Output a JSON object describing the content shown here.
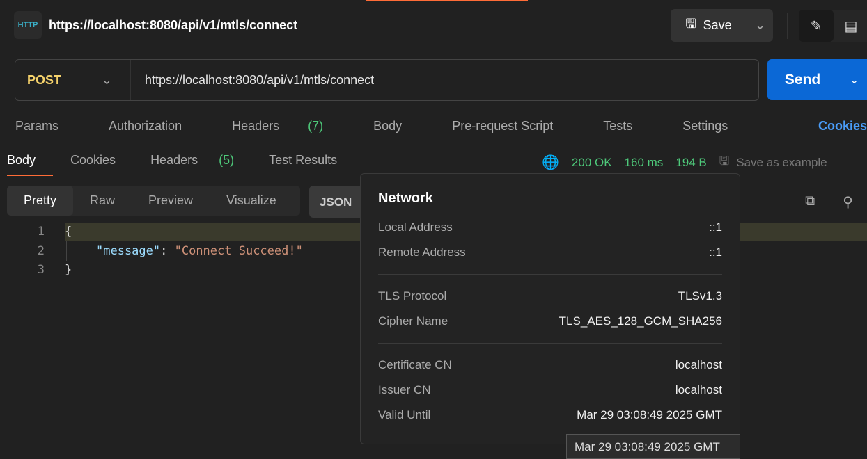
{
  "header": {
    "icon_text": "HTTP",
    "title": "https://localhost:8080/api/v1/mtls/connect",
    "save_label": "Save"
  },
  "request": {
    "method": "POST",
    "url": "https://localhost:8080/api/v1/mtls/connect",
    "send_label": "Send"
  },
  "request_tabs": [
    {
      "label": "Params"
    },
    {
      "label": "Authorization"
    },
    {
      "label": "Headers",
      "count": "(7)"
    },
    {
      "label": "Body"
    },
    {
      "label": "Pre-request Script"
    },
    {
      "label": "Tests"
    },
    {
      "label": "Settings"
    }
  ],
  "cookies_link": "Cookies",
  "response_tabs": [
    {
      "label": "Body",
      "active": true
    },
    {
      "label": "Cookies"
    },
    {
      "label": "Headers",
      "count": "(5)"
    },
    {
      "label": "Test Results"
    }
  ],
  "status": {
    "code": "200 OK",
    "time": "160 ms",
    "size": "194 B",
    "save_example": "Save as example",
    "color": "#4ec97a"
  },
  "format_tabs": [
    "Pretty",
    "Raw",
    "Preview",
    "Visualize"
  ],
  "format_type": "JSON",
  "code": {
    "lines": [
      "1",
      "2",
      "3"
    ],
    "open": "{",
    "key": "\"message\"",
    "colon": ": ",
    "value": "\"Connect Succeed!\"",
    "close": "}"
  },
  "network": {
    "title": "Network",
    "groups": [
      [
        {
          "label": "Local Address",
          "value": "::1"
        },
        {
          "label": "Remote Address",
          "value": "::1"
        }
      ],
      [
        {
          "label": "TLS Protocol",
          "value": "TLSv1.3"
        },
        {
          "label": "Cipher Name",
          "value": "TLS_AES_128_GCM_SHA256"
        }
      ],
      [
        {
          "label": "Certificate CN",
          "value": "localhost"
        },
        {
          "label": "Issuer CN",
          "value": "localhost"
        },
        {
          "label": "Valid Until",
          "value": "Mar 29 03:08:49 2025 GMT"
        }
      ]
    ]
  },
  "tooltip": "Mar 29 03:08:49 2025 GMT"
}
